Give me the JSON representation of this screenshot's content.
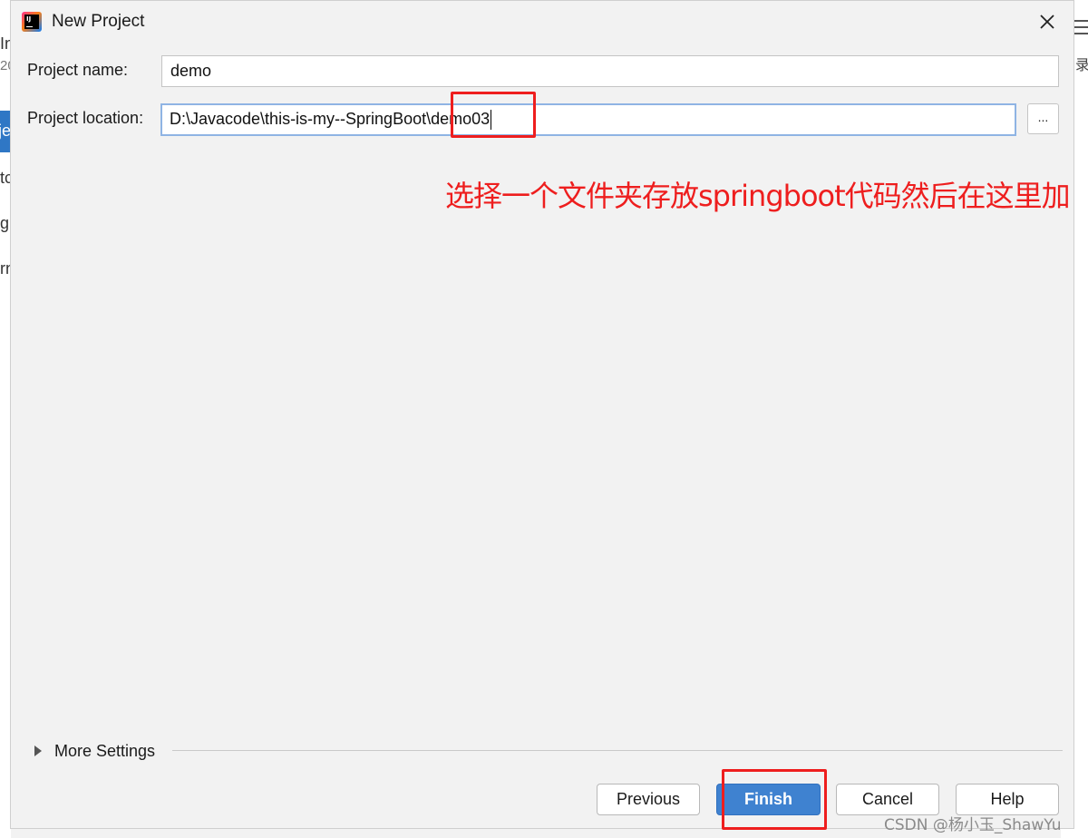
{
  "background": {
    "left_fragments": [
      "In",
      "20",
      "je",
      "tc",
      "gi",
      "rn"
    ],
    "right_glyph": "录"
  },
  "dialog": {
    "title": "New Project",
    "icon": "intellij-idea-icon",
    "close_icon": "close-icon"
  },
  "form": {
    "project_name_label": "Project name:",
    "project_name_value": "demo",
    "project_location_label": "Project location:",
    "project_location_value": "D:\\Javacode\\this-is-my--SpringBoot\\demo03",
    "browse_label": "..."
  },
  "annotation": {
    "text": "选择一个文件夹存放springboot代码然后在这里加",
    "color": "#ee1e1e"
  },
  "more_settings": {
    "label": "More Settings"
  },
  "buttons": {
    "previous": "Previous",
    "finish": "Finish",
    "cancel": "Cancel",
    "help": "Help"
  },
  "watermark": "CSDN @杨小玉_ShawYu",
  "colors": {
    "primary_button": "#3f82d0",
    "focus_border": "#8fb4e4",
    "dialog_bg": "#f2f2f2"
  }
}
